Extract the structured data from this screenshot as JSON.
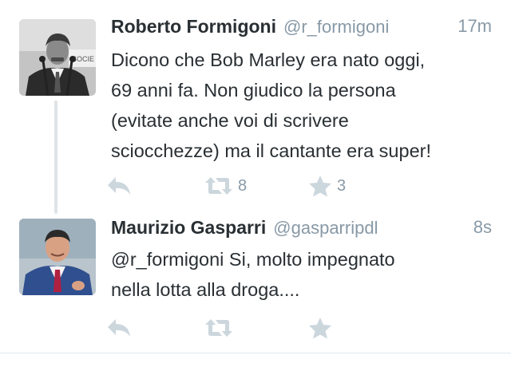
{
  "tweets": [
    {
      "name": "Roberto Formigoni",
      "handle": "@r_formigoni",
      "time": "17m",
      "lines": [
        "Dicono che Bob Marley era nato oggi,",
        "69 anni fa. Non giudico la persona",
        "(evitate anche voi di scrivere",
        "sciocchezze) ma il cantante era super!"
      ],
      "retweets": "8",
      "favorites": "3",
      "avatar_sign": "SOCIE"
    },
    {
      "name": "Maurizio Gasparri",
      "handle": "@gasparripdl",
      "time": "8s",
      "lines": [
        "@r_formigoni Si, molto impegnato",
        "nella lotta alla droga...."
      ],
      "retweets": "",
      "favorites": ""
    }
  ],
  "colors": {
    "text": "#292f33",
    "muted": "#8899a6",
    "icon": "#ccd6dd",
    "thread_line": "#dfe4e8"
  },
  "icons": {
    "reply": "reply-icon",
    "retweet": "retweet-icon",
    "favorite": "star-icon"
  }
}
